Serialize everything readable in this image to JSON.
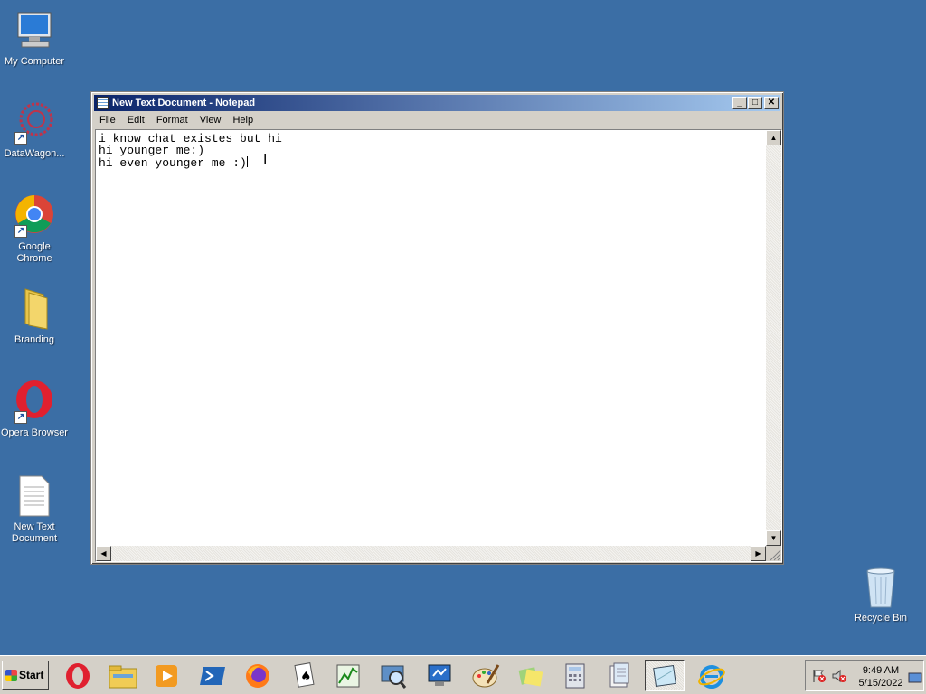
{
  "desktop": {
    "icons": [
      {
        "label": "My Computer"
      },
      {
        "label": "DataWagon..."
      },
      {
        "label": "Google Chrome"
      },
      {
        "label": "Branding"
      },
      {
        "label": "Opera Browser"
      },
      {
        "label": "New Text Document"
      },
      {
        "label": "Recycle Bin"
      }
    ]
  },
  "notepad": {
    "title": "New Text Document - Notepad",
    "menu": [
      "File",
      "Edit",
      "Format",
      "View",
      "Help"
    ],
    "lines": [
      "i know chat existes but hi",
      "hi younger me:)",
      "hi even younger me :)"
    ],
    "buttons": {
      "minimize": "_",
      "maximize": "□",
      "close": "✕"
    }
  },
  "taskbar": {
    "start_label": "Start",
    "pinned": [
      "opera-icon",
      "explorer-icon",
      "media-player-icon",
      "powershell-icon",
      "firefox-icon",
      "solitaire-icon",
      "task-manager-icon",
      "search-icon",
      "control-panel-icon",
      "paint-icon",
      "sticky-notes-icon",
      "calculator-icon",
      "documents-icon",
      "notepad-icon",
      "internet-explorer-icon"
    ],
    "clock": {
      "time": "9:49 AM",
      "date": "5/15/2022"
    }
  },
  "colors": {
    "desktop": "#3b6ea5",
    "titlebar": "#0a246a"
  }
}
